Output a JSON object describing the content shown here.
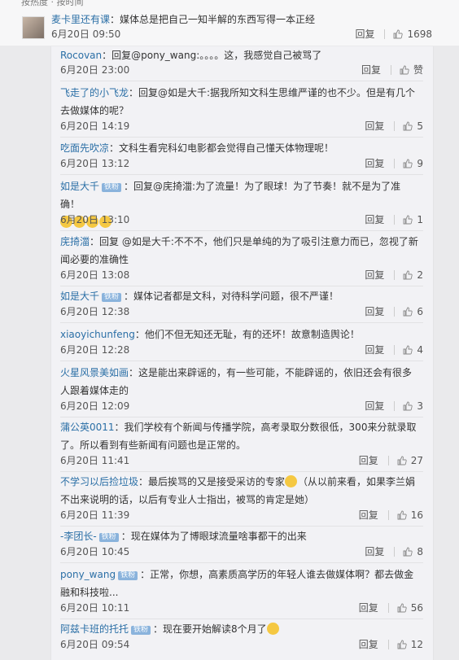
{
  "top_fragment": "按热度 · 按时间",
  "main": {
    "author": "麦卡里还有课",
    "text": "：媒体总是把自己一知半解的东西写得一本正经",
    "time": "6月20日 09:50",
    "reply_label": "回复",
    "likes": "1698"
  },
  "badge_label": "铁粉",
  "reply_label": "回复",
  "replies": [
    {
      "author": "Rocovan",
      "text": "：回复@pony_wang:。。。。这，我感觉自己被骂了",
      "time": "6月20日 23:00",
      "likes": "赞"
    },
    {
      "author": "飞走了的小飞龙",
      "text": "：回复@如是大千:据我所知文科生思维严谨的也不少。但是有几个去做媒体的呢？",
      "time": "6月20日 14:19",
      "likes": "5"
    },
    {
      "author": "吃面先吹凉",
      "text": "：文科生看完科幻电影都会觉得自己懂天体物理呢！",
      "time": "6月20日 13:12",
      "likes": "9"
    },
    {
      "author": "如是大千",
      "text": "：回复@庑掎湽:为了流量！为了眼球！为了节奏！就不是为了准确！",
      "time": "6月20日 13:10",
      "likes": "1"
    },
    {
      "author": "庑掎湽",
      "text": "：回复 @如是大千:不不不，他们只是单纯的为了吸引注意力而已，忽视了新闻必要的准确性",
      "time": "6月20日 13:08",
      "likes": "2"
    },
    {
      "author": "如是大千",
      "text": "：媒体记者都是文科，对待科学问题，很不严谨！",
      "time": "6月20日 12:38",
      "likes": "6"
    },
    {
      "author": "xiaoyichunfeng",
      "text": "：他们不但无知还无耻，有的还坏！故意制造舆论！",
      "time": "6月20日 12:28",
      "likes": "4"
    },
    {
      "author": "火星风景美如画",
      "text": "：这是能出来辟谣的，有一些可能，不能辟谣的，依旧还会有很多人跟着媒体走的",
      "time": "6月20日 12:09",
      "likes": "3"
    },
    {
      "author": "蒲公英0011",
      "text": "：我们学校有个新闻与传播学院，高考录取分数很低，300来分就录取了。所以看到有些新闻有问题也是正常的。",
      "time": "6月20日 11:41",
      "likes": "27"
    },
    {
      "author": "不学习以后捡垃圾",
      "text": "：最后挨骂的又是接受采访的专家",
      "text2": "（从以前来看，如果李兰娟不出来说明的话，以后有专业人士指出，被骂的肯定是她）",
      "time": "6月20日 11:39",
      "likes": "16"
    },
    {
      "author": "-李团长-",
      "text": "：现在媒体为了博眼球流量啥事都干的出来",
      "time": "6月20日 10:45",
      "likes": "8"
    },
    {
      "author": "pony_wang",
      "text": "：正常，你想，高素质高学历的年轻人谁去做媒体啊？都去做金融和科技啦...",
      "time": "6月20日 10:11",
      "likes": "56"
    },
    {
      "author": "阿兹卡班的托托",
      "text": "：现在要开始解读8个月了",
      "time": "6月20日 09:54",
      "likes": "12"
    }
  ],
  "colors": {
    "link": "#2b6fa6",
    "badge": "#8ab3dc",
    "panel": "#f2f2f5"
  }
}
